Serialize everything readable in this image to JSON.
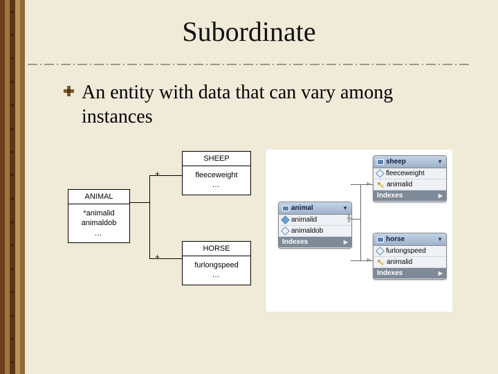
{
  "title": "Subordinate",
  "bullet": "An entity with data that can vary among instances",
  "er": {
    "animal": {
      "name": "ANIMAL",
      "attrs": [
        "*animalid",
        "animaldob"
      ],
      "ellipsis": "…"
    },
    "sheep": {
      "name": "SHEEP",
      "attrs": [
        "fleeceweight"
      ],
      "ellipsis": "…"
    },
    "horse": {
      "name": "HORSE",
      "attrs": [
        "furlongspeed"
      ],
      "ellipsis": "…"
    },
    "plus": "+"
  },
  "db": {
    "animal": {
      "name": "animal",
      "cols": [
        {
          "icon": "fill",
          "label": "animalid"
        },
        {
          "icon": "open",
          "label": "animaldob"
        }
      ],
      "footer": "Indexes"
    },
    "sheep": {
      "name": "sheep",
      "cols": [
        {
          "icon": "open",
          "label": "fleeceweight"
        },
        {
          "icon": "key",
          "label": "animalid"
        }
      ],
      "footer": "Indexes"
    },
    "horse": {
      "name": "horse",
      "cols": [
        {
          "icon": "open",
          "label": "furlongspeed"
        },
        {
          "icon": "key",
          "label": "animalid"
        }
      ],
      "footer": "Indexes"
    }
  }
}
